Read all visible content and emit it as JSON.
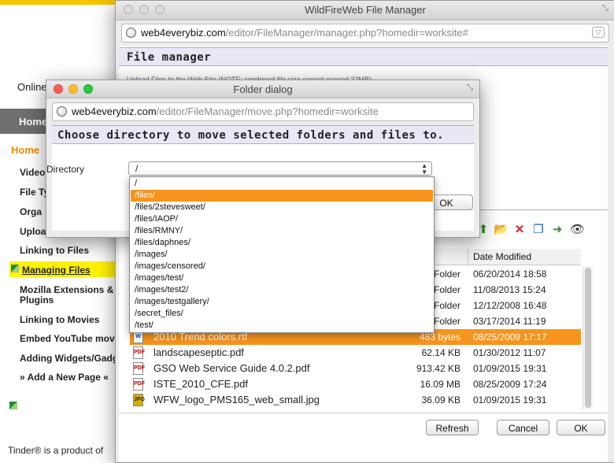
{
  "background_site": {
    "online_text": "Online",
    "home_bar": "Home",
    "home_link": "Home",
    "nav": [
      {
        "label": "Video"
      },
      {
        "label": "File Ty"
      },
      {
        "label": "Orga"
      },
      {
        "label": "Uploa"
      },
      {
        "label": "Linking to Files"
      },
      {
        "label": "Mozilla Extensions &"
      },
      {
        "label": "Plugins"
      },
      {
        "label": "Linking to Movies"
      },
      {
        "label": "Embed YouTube mov"
      },
      {
        "label": "Adding Widgets/Gadg"
      },
      {
        "label": "» Add a New Page «"
      }
    ],
    "active_nav": "Managing Files",
    "footer": "Tinder® is a product of"
  },
  "file_manager": {
    "window_title": "WildFireWeb File Manager",
    "url_host": "web4everybiz.com",
    "url_path": "/editor/FileManager/manager.php?homedir=worksite#",
    "heading": "File manager",
    "upload_note": "Upload Files to the Web Site   (NOTE: combined file size cannot exceed 32MB)",
    "columns": {
      "modified": "Date Modified"
    },
    "toolbar_icons": [
      "up-folder-icon",
      "new-folder-icon",
      "delete-icon",
      "copy-icon",
      "move-icon",
      "view-icon"
    ],
    "rows": [
      {
        "name": "",
        "size": "Folder",
        "date": "06/20/2014 18:58",
        "icon": "folder"
      },
      {
        "name": "",
        "size": "Folder",
        "date": "11/08/2013 15:24",
        "icon": "folder"
      },
      {
        "name": "",
        "size": "Folder",
        "date": "12/12/2008 16:48",
        "icon": "folder"
      },
      {
        "name": "",
        "size": "Folder",
        "date": "03/17/2014 11:19",
        "icon": "folder"
      },
      {
        "name": "2010 Trend colors.rtf",
        "size": "483 bytes",
        "date": "08/25/2009 17:17",
        "icon": "doc",
        "selected": true
      },
      {
        "name": "landscapeseptic.pdf",
        "size": "62.14 KB",
        "date": "01/30/2012 11:07",
        "icon": "pdf"
      },
      {
        "name": "GSO Web Service Guide 4.0.2.pdf",
        "size": "913.42 KB",
        "date": "01/09/2015 19:31",
        "icon": "pdf"
      },
      {
        "name": "ISTE_2010_CFE.pdf",
        "size": "16.09 MB",
        "date": "08/25/2009 17:24",
        "icon": "pdf"
      },
      {
        "name": "WFW_logo_PMS165_web_small.jpg",
        "size": "36.09 KB",
        "date": "01/09/2015 19:31",
        "icon": "jpg"
      }
    ],
    "buttons": {
      "refresh": "Refresh",
      "cancel": "Cancel",
      "ok": "OK"
    }
  },
  "folder_dialog": {
    "window_title": "Folder dialog",
    "url_host": "web4everybiz.com",
    "url_path": "/editor/FileManager/move.php?homedir=worksite",
    "heading": "Choose directory to move selected folders and files to.",
    "directory_label": "Directory",
    "selected_value": "/",
    "ok_label": "OK",
    "options": [
      {
        "label": "/"
      },
      {
        "label": "/files/",
        "highlighted": true
      },
      {
        "label": "/files/2stevesweet/"
      },
      {
        "label": "/files/IAOP/"
      },
      {
        "label": "/files/RMNY/"
      },
      {
        "label": "/files/daphnes/"
      },
      {
        "label": "/images/"
      },
      {
        "label": "/images/censored/"
      },
      {
        "label": "/images/test/"
      },
      {
        "label": "/images/test2/"
      },
      {
        "label": "/images/testgallery/"
      },
      {
        "label": "/secret_files/"
      },
      {
        "label": "/test/"
      }
    ]
  },
  "colors": {
    "accent": "#f7941d",
    "site_yellow": "#fff200",
    "home_orange": "#f08a00"
  }
}
